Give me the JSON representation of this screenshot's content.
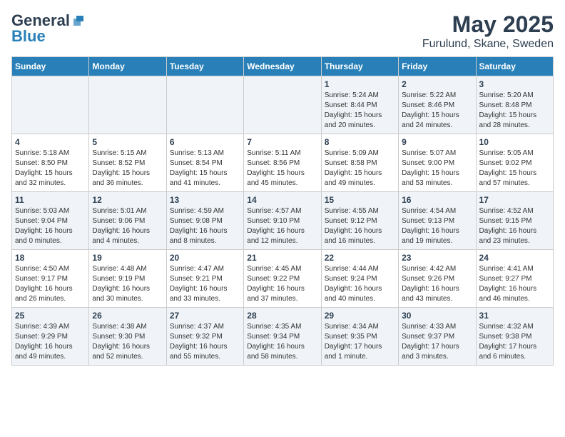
{
  "header": {
    "logo_general": "General",
    "logo_blue": "Blue",
    "month_title": "May 2025",
    "location": "Furulund, Skane, Sweden"
  },
  "days_of_week": [
    "Sunday",
    "Monday",
    "Tuesday",
    "Wednesday",
    "Thursday",
    "Friday",
    "Saturday"
  ],
  "weeks": [
    [
      {
        "day": "",
        "info": ""
      },
      {
        "day": "",
        "info": ""
      },
      {
        "day": "",
        "info": ""
      },
      {
        "day": "",
        "info": ""
      },
      {
        "day": "1",
        "info": "Sunrise: 5:24 AM\nSunset: 8:44 PM\nDaylight: 15 hours\nand 20 minutes."
      },
      {
        "day": "2",
        "info": "Sunrise: 5:22 AM\nSunset: 8:46 PM\nDaylight: 15 hours\nand 24 minutes."
      },
      {
        "day": "3",
        "info": "Sunrise: 5:20 AM\nSunset: 8:48 PM\nDaylight: 15 hours\nand 28 minutes."
      }
    ],
    [
      {
        "day": "4",
        "info": "Sunrise: 5:18 AM\nSunset: 8:50 PM\nDaylight: 15 hours\nand 32 minutes."
      },
      {
        "day": "5",
        "info": "Sunrise: 5:15 AM\nSunset: 8:52 PM\nDaylight: 15 hours\nand 36 minutes."
      },
      {
        "day": "6",
        "info": "Sunrise: 5:13 AM\nSunset: 8:54 PM\nDaylight: 15 hours\nand 41 minutes."
      },
      {
        "day": "7",
        "info": "Sunrise: 5:11 AM\nSunset: 8:56 PM\nDaylight: 15 hours\nand 45 minutes."
      },
      {
        "day": "8",
        "info": "Sunrise: 5:09 AM\nSunset: 8:58 PM\nDaylight: 15 hours\nand 49 minutes."
      },
      {
        "day": "9",
        "info": "Sunrise: 5:07 AM\nSunset: 9:00 PM\nDaylight: 15 hours\nand 53 minutes."
      },
      {
        "day": "10",
        "info": "Sunrise: 5:05 AM\nSunset: 9:02 PM\nDaylight: 15 hours\nand 57 minutes."
      }
    ],
    [
      {
        "day": "11",
        "info": "Sunrise: 5:03 AM\nSunset: 9:04 PM\nDaylight: 16 hours\nand 0 minutes."
      },
      {
        "day": "12",
        "info": "Sunrise: 5:01 AM\nSunset: 9:06 PM\nDaylight: 16 hours\nand 4 minutes."
      },
      {
        "day": "13",
        "info": "Sunrise: 4:59 AM\nSunset: 9:08 PM\nDaylight: 16 hours\nand 8 minutes."
      },
      {
        "day": "14",
        "info": "Sunrise: 4:57 AM\nSunset: 9:10 PM\nDaylight: 16 hours\nand 12 minutes."
      },
      {
        "day": "15",
        "info": "Sunrise: 4:55 AM\nSunset: 9:12 PM\nDaylight: 16 hours\nand 16 minutes."
      },
      {
        "day": "16",
        "info": "Sunrise: 4:54 AM\nSunset: 9:13 PM\nDaylight: 16 hours\nand 19 minutes."
      },
      {
        "day": "17",
        "info": "Sunrise: 4:52 AM\nSunset: 9:15 PM\nDaylight: 16 hours\nand 23 minutes."
      }
    ],
    [
      {
        "day": "18",
        "info": "Sunrise: 4:50 AM\nSunset: 9:17 PM\nDaylight: 16 hours\nand 26 minutes."
      },
      {
        "day": "19",
        "info": "Sunrise: 4:48 AM\nSunset: 9:19 PM\nDaylight: 16 hours\nand 30 minutes."
      },
      {
        "day": "20",
        "info": "Sunrise: 4:47 AM\nSunset: 9:21 PM\nDaylight: 16 hours\nand 33 minutes."
      },
      {
        "day": "21",
        "info": "Sunrise: 4:45 AM\nSunset: 9:22 PM\nDaylight: 16 hours\nand 37 minutes."
      },
      {
        "day": "22",
        "info": "Sunrise: 4:44 AM\nSunset: 9:24 PM\nDaylight: 16 hours\nand 40 minutes."
      },
      {
        "day": "23",
        "info": "Sunrise: 4:42 AM\nSunset: 9:26 PM\nDaylight: 16 hours\nand 43 minutes."
      },
      {
        "day": "24",
        "info": "Sunrise: 4:41 AM\nSunset: 9:27 PM\nDaylight: 16 hours\nand 46 minutes."
      }
    ],
    [
      {
        "day": "25",
        "info": "Sunrise: 4:39 AM\nSunset: 9:29 PM\nDaylight: 16 hours\nand 49 minutes."
      },
      {
        "day": "26",
        "info": "Sunrise: 4:38 AM\nSunset: 9:30 PM\nDaylight: 16 hours\nand 52 minutes."
      },
      {
        "day": "27",
        "info": "Sunrise: 4:37 AM\nSunset: 9:32 PM\nDaylight: 16 hours\nand 55 minutes."
      },
      {
        "day": "28",
        "info": "Sunrise: 4:35 AM\nSunset: 9:34 PM\nDaylight: 16 hours\nand 58 minutes."
      },
      {
        "day": "29",
        "info": "Sunrise: 4:34 AM\nSunset: 9:35 PM\nDaylight: 17 hours\nand 1 minute."
      },
      {
        "day": "30",
        "info": "Sunrise: 4:33 AM\nSunset: 9:37 PM\nDaylight: 17 hours\nand 3 minutes."
      },
      {
        "day": "31",
        "info": "Sunrise: 4:32 AM\nSunset: 9:38 PM\nDaylight: 17 hours\nand 6 minutes."
      }
    ]
  ]
}
